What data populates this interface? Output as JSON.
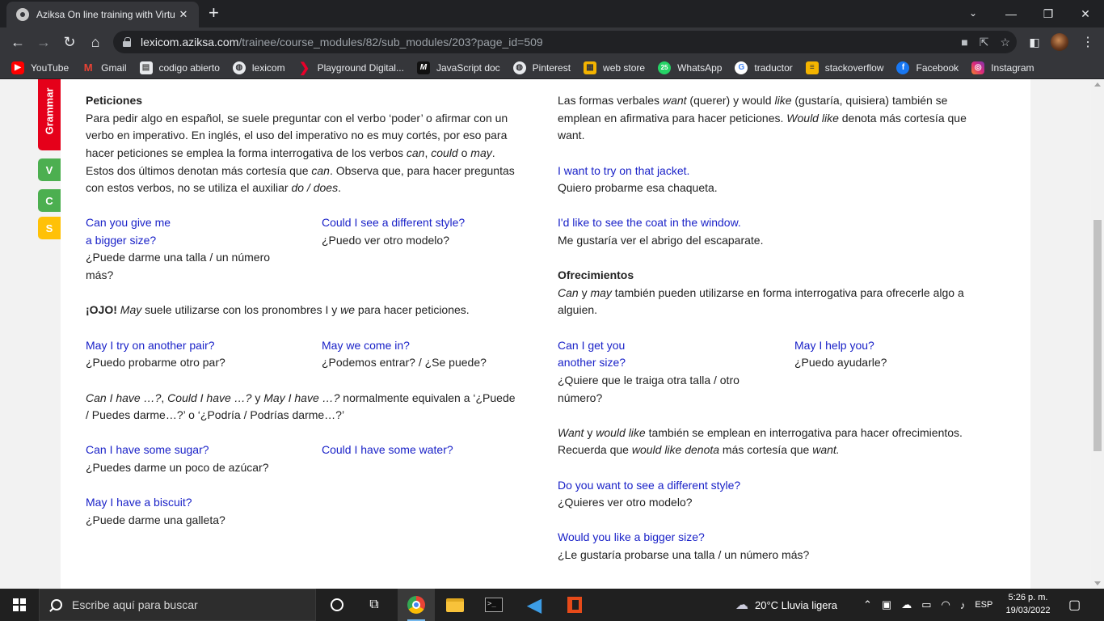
{
  "browser": {
    "tab_title": "Aziksa On line training with Virtu",
    "url_host": "lexicom.aziksa.com",
    "url_path": "/trainee/course_modules/82/sub_modules/203?page_id=509"
  },
  "bookmarks": [
    {
      "label": "YouTube",
      "icon": "youtube-icon",
      "color": "#ff0000"
    },
    {
      "label": "Gmail",
      "icon": "gmail-icon",
      "color": "#ea4335"
    },
    {
      "label": "codigo abierto",
      "icon": "page-icon",
      "color": "#9aa0a6"
    },
    {
      "label": "lexicom",
      "icon": "globe-icon",
      "color": "#e8eaed"
    },
    {
      "label": "Playground Digital...",
      "icon": "chevron-icon",
      "color": "#e8002a"
    },
    {
      "label": "JavaScript doc",
      "icon": "m-icon",
      "color": "#000000"
    },
    {
      "label": "Pinterest",
      "icon": "globe-icon",
      "color": "#e8eaed"
    },
    {
      "label": "web store",
      "icon": "store-icon",
      "color": "#f4b400"
    },
    {
      "label": "WhatsApp",
      "icon": "whatsapp-icon",
      "color": "#25d366"
    },
    {
      "label": "traductor",
      "icon": "google-icon",
      "color": "#ffffff"
    },
    {
      "label": "stackoverflow",
      "icon": "stackoverflow-icon",
      "color": "#f48024"
    },
    {
      "label": "Facebook",
      "icon": "facebook-icon",
      "color": "#1877f2"
    },
    {
      "label": "Instagram",
      "icon": "instagram-icon",
      "color": "#e1306c"
    }
  ],
  "sidebar": {
    "grammar": "Grammar",
    "v": "V",
    "c": "C",
    "s": "S"
  },
  "content": {
    "left": {
      "peticiones_title": "Peticiones",
      "intro_1": "Para pedir algo en español, se suele preguntar con el verbo ‘poder’ o afirmar con un",
      "intro_2": "verbo en imperativo. En inglés, el uso del imperativo no es muy cortés, por eso para",
      "intro_3a": "hacer peticiones se emplea la forma interrogativa de los verbos ",
      "can": "can",
      "sep_comma": ", ",
      "could": "could",
      "o": " o ",
      "may": "may",
      "dot": ".",
      "intro_4a": "Estos dos últimos denotan más cortesía que ",
      "intro_4b": ". Observa que, para hacer preguntas",
      "intro_5a": "con estos verbos, no se utiliza el auxiliar ",
      "do_does": "do / does",
      "ex1_en_1": "Can you give me",
      "ex1_en_2": "a bigger size?",
      "ex1_es_1": "¿Puede darme una talla / un número",
      "ex1_es_2": "más?",
      "ex2_en": "Could I see a different style?",
      "ex2_es": "¿Puedo ver otro modelo?",
      "ojo": "¡OJO!",
      "ojo_may": "May",
      "ojo_mid": " suele utilizarse con los pronombres I y ",
      "ojo_we": "we",
      "ojo_end": " para hacer peticiones.",
      "ex3_en": "May I try on another pair?",
      "ex3_es": "¿Puedo probarme otro par?",
      "ex4_en": "May we come in?",
      "ex4_es": "¿Podemos entrar? / ¿Se puede?",
      "note_can": "Can I have …?",
      "note_could": "Could I have …?",
      "note_y": " y ",
      "note_may": "May I have …?",
      "note_rest": " normalmente equivalen a ‘¿Puede",
      "note_2": "/ Puedes darme…?’ o ‘¿Podría / Podrías darme…?’",
      "ex5_en": "Can I have some sugar?",
      "ex5_es": "¿Puedes darme un poco de azúcar?",
      "ex6_en": "Could I have some water?",
      "ex7_en": "May I have a biscuit?",
      "ex7_es": "¿Puede darme una galleta?"
    },
    "right": {
      "p1_a": "Las formas verbales ",
      "want": "want",
      "p1_b": " (querer) y would ",
      "like": "like",
      "p1_c": " (gustaría, quisiera) también se",
      "p1_2a": "emplean en afirmativa para hacer peticiones. ",
      "would_like": "Would like",
      "p1_2b": " denota más cortesía que",
      "p1_3": "want.",
      "ex1_en": "I want to try on that jacket.",
      "ex1_es": "Quiero probarme esa chaqueta.",
      "ex2_en": "I'd like to see the coat in the window.",
      "ex2_es": "Me gustaría ver el abrigo del escaparate.",
      "ofre_title": "Ofrecimientos",
      "ofre_can": "Can",
      "ofre_y": " y ",
      "ofre_may": "may",
      "ofre_rest": " también pueden utilizarse en forma interrogativa para ofrecerle algo a",
      "ofre_2": "alguien.",
      "ex3_en_1": "Can I get you",
      "ex3_en_2": "another size?",
      "ex3_es_1": "¿Quiere que le traiga otra talla / otro",
      "ex3_es_2": "número?",
      "ex4_en": "May I help you?",
      "ex4_es": "¿Puedo ayudarle?",
      "w_want": "Want",
      "w_y": " y ",
      "w_would": "would like",
      "w_rest": " también se emplean en interrogativa para hacer ofrecimientos.",
      "w2_a": "Recuerda que ",
      "w2_wl": "would like denota",
      "w2_b": " más cortesía que ",
      "w2_want": "want.",
      "ex5_en": "Do you want to see a different style?",
      "ex5_es": "¿Quieres ver otro modelo?",
      "ex6_en": "Would you like a bigger size?",
      "ex6_es": "¿Le gustaría probarse una talla / un número más?"
    }
  },
  "taskbar": {
    "search_placeholder": "Escribe aquí para buscar",
    "weather": "20°C  Lluvia ligera",
    "lang": "ESP",
    "time": "5:26 p. m.",
    "date": "19/03/2022"
  }
}
